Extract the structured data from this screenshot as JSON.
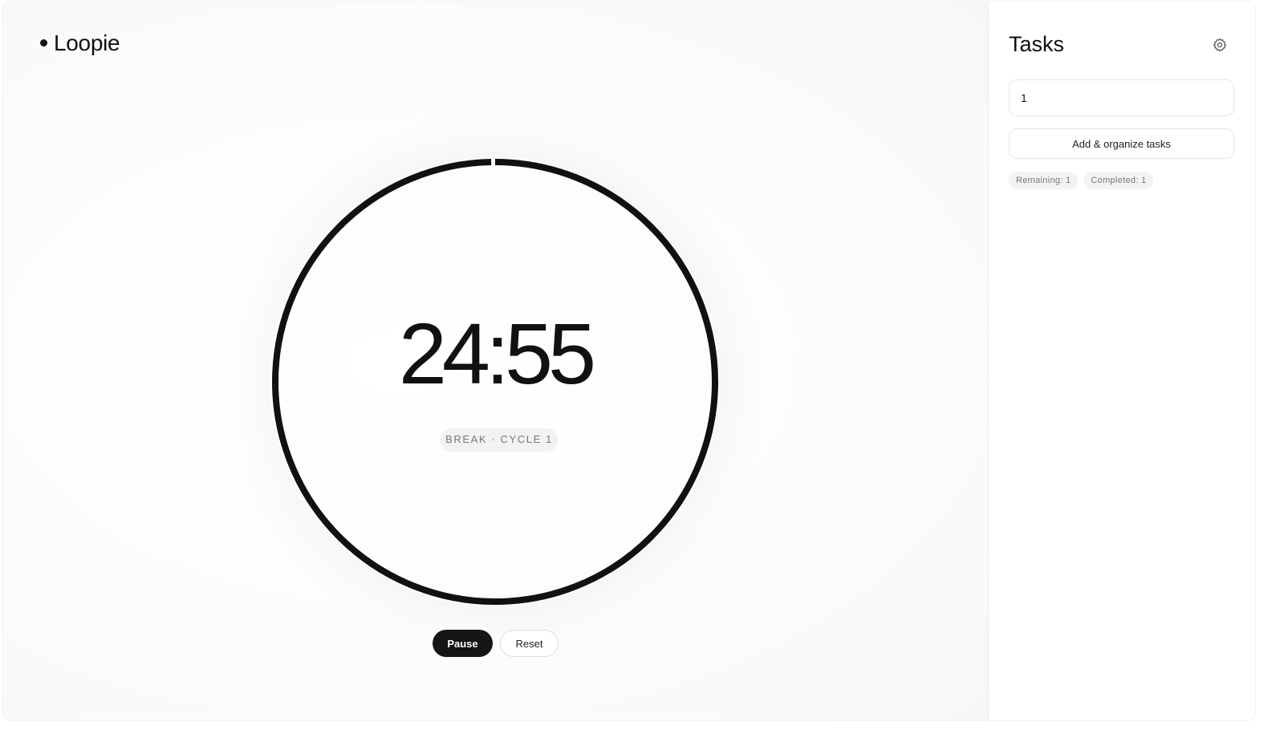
{
  "app": {
    "name": "Loopie"
  },
  "timer": {
    "time": "24:55",
    "phase_label": "BREAK · CYCLE 1",
    "progress": 0.997,
    "ring_color": "#111111"
  },
  "controls": {
    "pause_label": "Pause",
    "reset_label": "Reset"
  },
  "sidebar": {
    "title": "Tasks",
    "settings_icon": "gear-icon",
    "task_input_value": "1",
    "add_button_label": "Add & organize tasks",
    "remaining_label": "Remaining: 1",
    "completed_label": "Completed: 1"
  }
}
